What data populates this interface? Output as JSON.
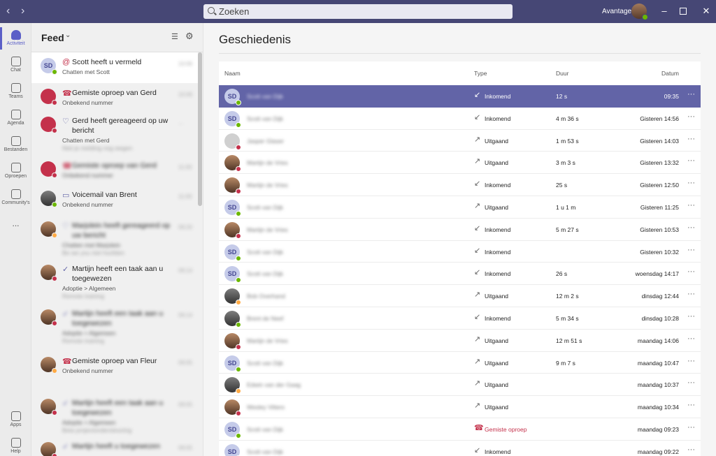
{
  "titlebar": {
    "search_placeholder": "Zoeken",
    "user_name": "Avantage",
    "back_icon": "chevron-left-icon",
    "forward_icon": "chevron-right-icon"
  },
  "rail": {
    "items": [
      {
        "label": "Activiteit",
        "icon": "bell-icon"
      },
      {
        "label": "Chat",
        "icon": "chat-icon"
      },
      {
        "label": "Teams",
        "icon": "teams-icon"
      },
      {
        "label": "Agenda",
        "icon": "calendar-icon"
      },
      {
        "label": "Bestanden",
        "icon": "file-icon"
      },
      {
        "label": "Oproepen",
        "icon": "phone-icon"
      },
      {
        "label": "Community's",
        "icon": "community-icon"
      },
      {
        "label": "...",
        "icon": "more-icon"
      }
    ],
    "bottom": [
      {
        "label": "Apps",
        "icon": "apps-icon"
      },
      {
        "label": "Help",
        "icon": "help-icon"
      }
    ]
  },
  "feed": {
    "title": "Feed",
    "items": [
      {
        "initials": "SD",
        "icon": "@",
        "title": "Scott heeft u vermeld",
        "sub": "Chatten met Scott",
        "time": "10:06"
      },
      {
        "initials": "",
        "icon": "☎",
        "title": "Gemiste oproep van Gerd",
        "sub": "Onbekend nummer",
        "time": "10:06"
      },
      {
        "initials": "",
        "icon": "♡",
        "title": "Gerd heeft gereageerd op uw bericht",
        "sub": "Chatten met Gerd",
        "sub2": "Niet je melding nog wegen",
        "time": "..."
      },
      {
        "initials": "",
        "icon": "☎",
        "title": "Gemiste oproep van Gerd",
        "sub": "Onbekend nummer",
        "time": "11:00"
      },
      {
        "initials": "",
        "icon": "▭",
        "title": "Voicemail van Brent",
        "sub": "Onbekend nummer",
        "time": "11:00"
      },
      {
        "initials": "",
        "icon": "♡",
        "title": "Marjolein heeft gereageerd op uw bericht",
        "sub": "Chatten met Marjolein",
        "sub2": "Be we you niet hoofden",
        "time": "09:20"
      },
      {
        "initials": "",
        "icon": "✓",
        "title": "Martijn heeft een taak aan u toegewezen",
        "sub": "Adoptie > Algemeen",
        "sub2": "Remote training",
        "time": "09:14"
      },
      {
        "initials": "",
        "icon": "✓",
        "title": "Martijn heeft een taak aan u toegewezen",
        "sub": "Adoptie > Algemeen",
        "sub2": "Remote training",
        "time": "09:14"
      },
      {
        "initials": "",
        "icon": "☎",
        "title": "Gemiste oproep van Fleur",
        "sub": "Onbekend nummer",
        "time": "09:05"
      },
      {
        "initials": "",
        "icon": "✓",
        "title": "Martijn heeft een taak aan u toegewezen",
        "sub": "Adoptie > Algemeen",
        "sub2": "Beta projectondersteuning",
        "time": "09:05"
      },
      {
        "initials": "",
        "icon": "✓",
        "title": "Martijn heeft u toegewezen",
        "sub": "",
        "time": "09:05"
      }
    ]
  },
  "history": {
    "title": "Geschiedenis",
    "columns": {
      "name": "Naam",
      "type": "Type",
      "duration": "Duur",
      "date": "Datum"
    },
    "rows": [
      {
        "initials": "SD",
        "name": "Scott van Dijk",
        "type": "Inkomend",
        "dir": "in",
        "duration": "12 s",
        "date": "09:35",
        "status": "green",
        "avatar": "sd"
      },
      {
        "initials": "SD",
        "name": "Scott van Dijk",
        "type": "Inkomend",
        "dir": "in",
        "duration": "4 m 36 s",
        "date": "Gisteren 14:56",
        "status": "green",
        "avatar": "sd"
      },
      {
        "initials": "",
        "name": "Jasper Glaser",
        "type": "Uitgaand",
        "dir": "out",
        "duration": "1 m 53 s",
        "date": "Gisteren 14:03",
        "status": "red",
        "avatar": "grey"
      },
      {
        "initials": "",
        "name": "Martijn de Vries",
        "type": "Uitgaand",
        "dir": "out",
        "duration": "3 m 3 s",
        "date": "Gisteren 13:32",
        "status": "red",
        "avatar": "photo"
      },
      {
        "initials": "",
        "name": "Martijn de Vries",
        "type": "Inkomend",
        "dir": "in",
        "duration": "25 s",
        "date": "Gisteren 12:50",
        "status": "red",
        "avatar": "photo"
      },
      {
        "initials": "SD",
        "name": "Scott van Dijk",
        "type": "Uitgaand",
        "dir": "out",
        "duration": "1 u 1 m",
        "date": "Gisteren 11:25",
        "status": "green",
        "avatar": "sd"
      },
      {
        "initials": "",
        "name": "Martijn de Vries",
        "type": "Inkomend",
        "dir": "in",
        "duration": "5 m 27 s",
        "date": "Gisteren 10:53",
        "status": "red",
        "avatar": "photo"
      },
      {
        "initials": "SD",
        "name": "Scott van Dijk",
        "type": "Inkomend",
        "dir": "in",
        "duration": "",
        "date": "Gisteren 10:32",
        "status": "green",
        "avatar": "sd"
      },
      {
        "initials": "SD",
        "name": "Scott van Dijk",
        "type": "Inkomend",
        "dir": "in",
        "duration": "26 s",
        "date": "woensdag 14:17",
        "status": "green",
        "avatar": "sd"
      },
      {
        "initials": "",
        "name": "Bob Overhand",
        "type": "Uitgaand",
        "dir": "out",
        "duration": "12 m 2 s",
        "date": "dinsdag 12:44",
        "status": "yellow",
        "avatar": "photo2"
      },
      {
        "initials": "",
        "name": "Brent de Neef",
        "type": "Inkomend",
        "dir": "in",
        "duration": "5 m 34 s",
        "date": "dinsdag 10:28",
        "status": "green",
        "avatar": "photo2"
      },
      {
        "initials": "",
        "name": "Martijn de Vries",
        "type": "Uitgaand",
        "dir": "out",
        "duration": "12 m 51 s",
        "date": "maandag 14:06",
        "status": "red",
        "avatar": "photo"
      },
      {
        "initials": "SD",
        "name": "Scott van Dijk",
        "type": "Uitgaand",
        "dir": "out",
        "duration": "9 m 7 s",
        "date": "maandag 10:47",
        "status": "green",
        "avatar": "sd"
      },
      {
        "initials": "",
        "name": "Edwin van der Gaag",
        "type": "Uitgaand",
        "dir": "out",
        "duration": "",
        "date": "maandag 10:37",
        "status": "yellow",
        "avatar": "photo2"
      },
      {
        "initials": "",
        "name": "Wesley Vitters",
        "type": "Uitgaand",
        "dir": "out",
        "duration": "",
        "date": "maandag 10:34",
        "status": "red",
        "avatar": "photo"
      },
      {
        "initials": "SD",
        "name": "Scott van Dijk",
        "type": "Gemiste oproep",
        "dir": "missed",
        "duration": "",
        "date": "maandag 09:23",
        "status": "green",
        "avatar": "sd"
      },
      {
        "initials": "SD",
        "name": "Scott van Dijk",
        "type": "Inkomend",
        "dir": "in",
        "duration": "",
        "date": "maandag 09:22",
        "status": "green",
        "avatar": "sd"
      }
    ]
  },
  "colors": {
    "accent": "#6264a7",
    "titlebar": "#464775",
    "missed": "#c4314b"
  }
}
